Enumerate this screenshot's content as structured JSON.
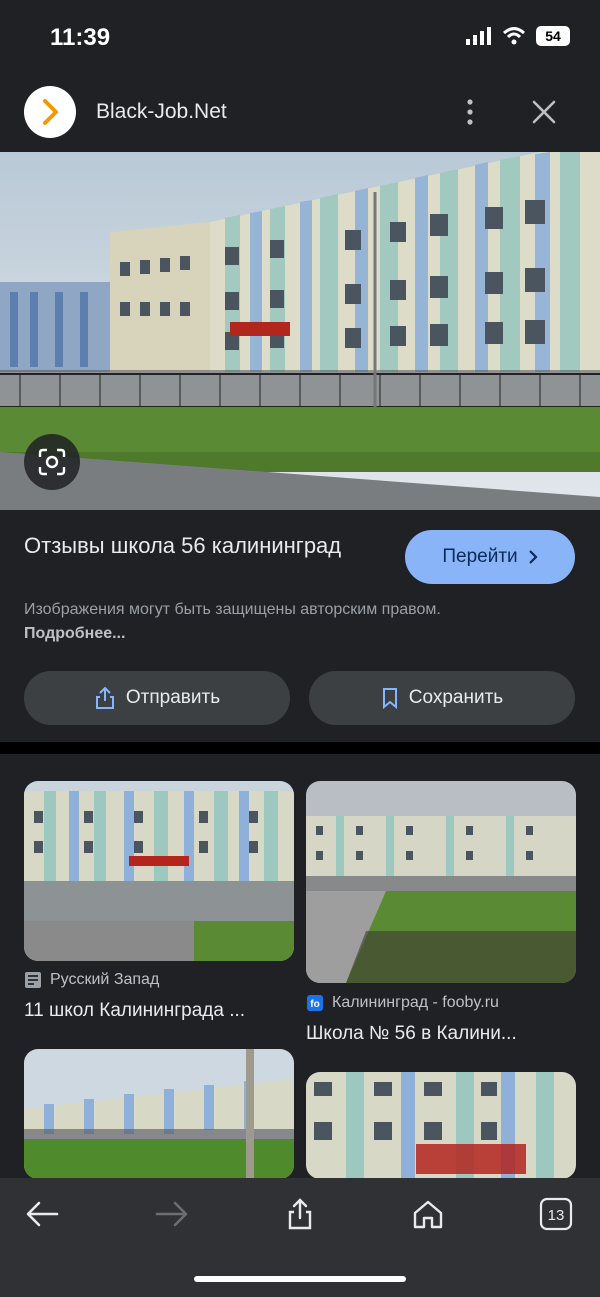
{
  "status": {
    "time": "11:39",
    "battery": "54"
  },
  "header": {
    "site_name": "Black-Job.Net"
  },
  "result": {
    "title": "Отзывы школа 56 калининград",
    "visit_label": "Перейти",
    "copyright_text": "Изображения могут быть защищены авторским правом.",
    "more_link": "Подробнее...",
    "share_label": "Отправить",
    "save_label": "Сохранить"
  },
  "related": [
    {
      "source": "Русский Запад",
      "title": "11 школ Калининграда ..."
    },
    {
      "source": "Калининград - fooby.ru",
      "title": "Школа № 56 в Калини..."
    }
  ],
  "nav": {
    "tab_count": "13"
  },
  "colors": {
    "accent": "#8ab4f8",
    "background": "#202124",
    "button_bg": "#3c4043"
  },
  "icons": [
    "chevron-right-logo-icon",
    "more-vertical-icon",
    "close-icon",
    "lens-icon",
    "share-icon",
    "bookmark-icon",
    "back-icon",
    "forward-icon",
    "home-icon",
    "tabs-icon"
  ]
}
